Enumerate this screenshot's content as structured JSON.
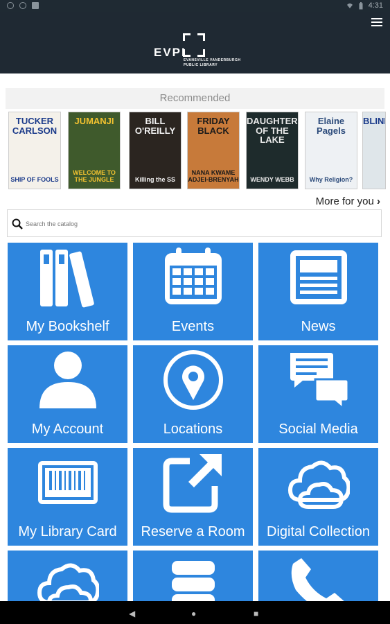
{
  "status_bar": {
    "time": "4:31"
  },
  "header": {
    "logo_text": "EVPL",
    "logo_subtext_line1": "EVANSVILLE VANDERBURGH",
    "logo_subtext_line2": "PUBLIC LIBRARY",
    "menu_icon": "hamburger-menu-icon"
  },
  "recommended": {
    "heading": "Recommended",
    "more_label": "More for you",
    "books": [
      {
        "title": "TUCKER CARLSON",
        "subtitle": "SHIP OF FOOLS",
        "bg": "#f4f1ea",
        "fg": "#1a3a8a"
      },
      {
        "title": "JUMANJI",
        "subtitle": "WELCOME TO THE JUNGLE",
        "bg": "#3f5a2c",
        "fg": "#f2c230"
      },
      {
        "title": "BILL O'REILLY",
        "subtitle": "Killing the SS",
        "bg": "#2b2520",
        "fg": "#f2f2f2"
      },
      {
        "title": "FRIDAY BLACK",
        "subtitle": "NANA KWAME ADJEI-BRENYAH",
        "bg": "#c77a3a",
        "fg": "#1a1a1a"
      },
      {
        "title": "DAUGHTERS OF THE LAKE",
        "subtitle": "WENDY WEBB",
        "bg": "#1e2b2c",
        "fg": "#e8e8e8"
      },
      {
        "title": "Elaine Pagels",
        "subtitle": "Why Religion?",
        "bg": "#eef1f4",
        "fg": "#2b4a7a"
      },
      {
        "title": "BLIND",
        "subtitle": "",
        "bg": "#dfe6ea",
        "fg": "#1a3a8a"
      }
    ]
  },
  "search": {
    "placeholder": "Search the catalog"
  },
  "tiles": [
    {
      "label": "My Bookshelf",
      "icon": "bookshelf-icon"
    },
    {
      "label": "Events",
      "icon": "calendar-icon"
    },
    {
      "label": "News",
      "icon": "newspaper-icon"
    },
    {
      "label": "My Account",
      "icon": "user-icon"
    },
    {
      "label": "Locations",
      "icon": "map-pin-icon"
    },
    {
      "label": "Social Media",
      "icon": "chat-bubbles-icon"
    },
    {
      "label": "My Library Card",
      "icon": "barcode-card-icon"
    },
    {
      "label": "Reserve a Room",
      "icon": "external-link-icon"
    },
    {
      "label": "Digital Collection",
      "icon": "cloud-icon"
    },
    {
      "label": "",
      "icon": "cloud-icon"
    },
    {
      "label": "",
      "icon": "database-icon"
    },
    {
      "label": "",
      "icon": "phone-icon"
    }
  ],
  "colors": {
    "tile": "#2e86de",
    "header": "#1f2933"
  }
}
